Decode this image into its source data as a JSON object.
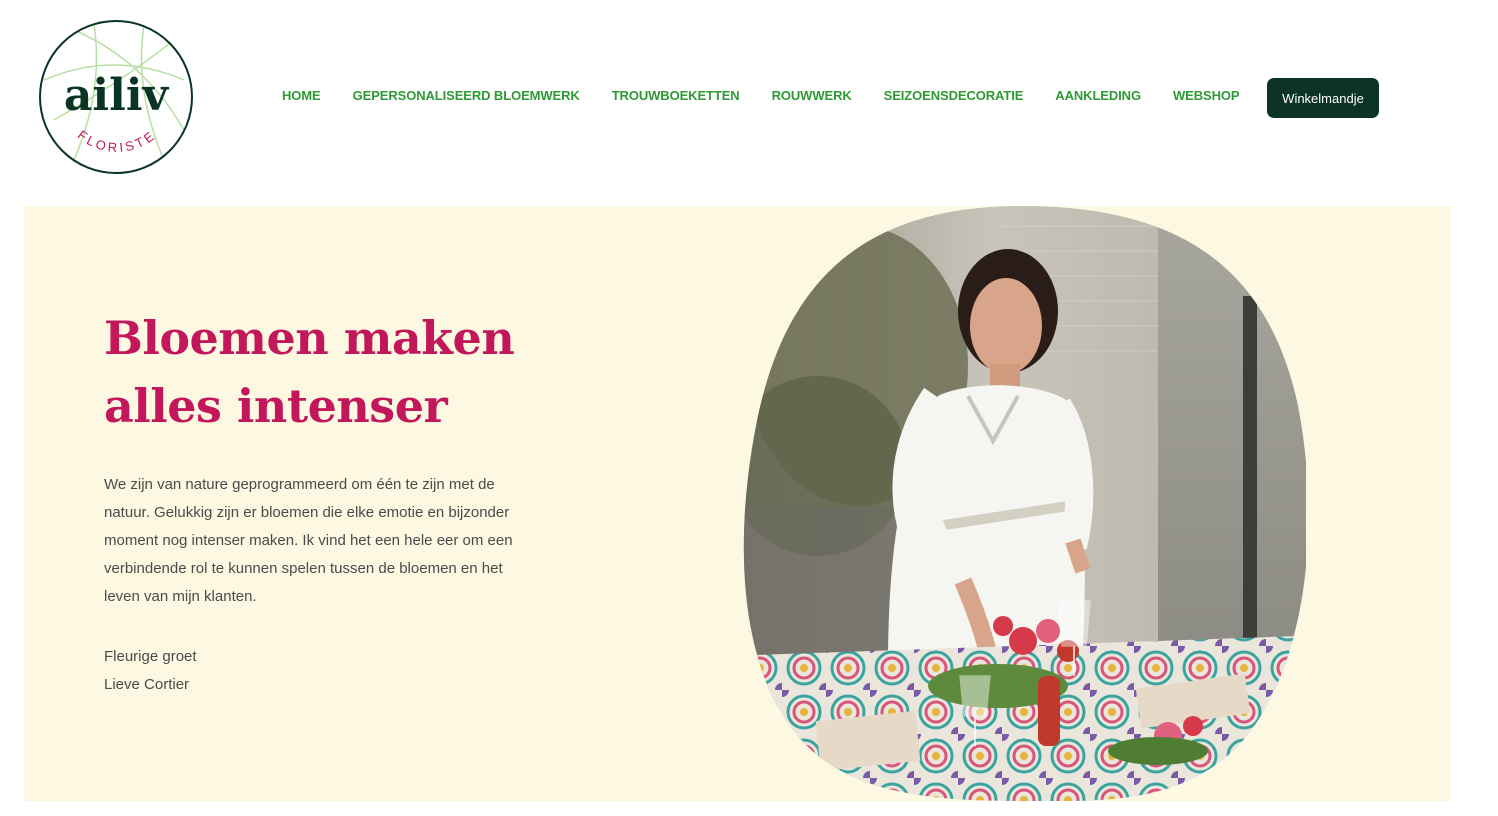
{
  "brand": {
    "name": "ailiv",
    "tagline": "FLORISTE",
    "colors": {
      "dark_green": "#0c3426",
      "leaf_green": "#9ed08a",
      "pink": "#c2185b"
    }
  },
  "nav": {
    "items": [
      {
        "label": "HOME"
      },
      {
        "label": "GEPERSONALISEERD BLOEMWERK"
      },
      {
        "label": "TROUWBOEKETTEN"
      },
      {
        "label": "ROUWWERK"
      },
      {
        "label": "SEIZOENSDECORATIE"
      },
      {
        "label": "AANKLEDING"
      },
      {
        "label": "WEBSHOP"
      }
    ],
    "color": "#2f9a35"
  },
  "cart": {
    "label": "Winkelmandje"
  },
  "hero": {
    "title_line1": "Bloemen maken",
    "title_line2": "alles intenser",
    "body": "We zijn van nature geprogrammeerd om één te zijn met de natuur. Gelukkig zijn er bloemen die elke emotie en bijzonder moment nog intenser maken. Ik vind het een hele eer om een verbindende rol te kunnen spelen tussen de bloemen en het leven van mijn klanten.",
    "greeting": "Fleurige groet",
    "signature": "Lieve Cortier",
    "background": "#fdf8e1"
  },
  "photo": {
    "icon": "florist-portrait-photo"
  }
}
